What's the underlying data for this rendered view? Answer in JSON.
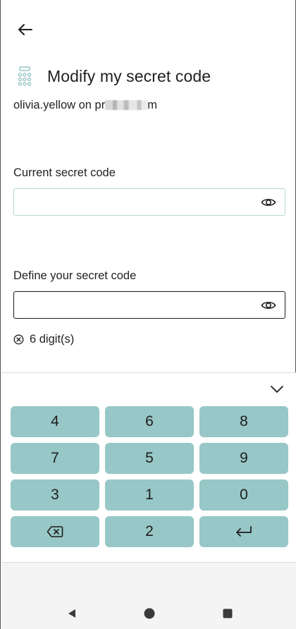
{
  "header": {
    "back_icon": "arrow-left-icon",
    "title": "Modify my secret code",
    "title_icon": "keypad-icon",
    "account_prefix": "olivia.yellow on pr",
    "account_suffix": "m"
  },
  "current_code": {
    "label": "Current secret code",
    "value": "",
    "toggle_icon": "eye-icon"
  },
  "new_code": {
    "label": "Define your secret code",
    "value": "",
    "toggle_icon": "eye-icon"
  },
  "rules": [
    {
      "icon": "x-circle-icon",
      "text": "6 digit(s)"
    }
  ],
  "keyboard": {
    "collapse_icon": "chevron-down-icon",
    "keys": [
      "4",
      "6",
      "8",
      "7",
      "5",
      "9",
      "3",
      "1",
      "0",
      "",
      "2",
      ""
    ],
    "key_icons": [
      "backspace-icon",
      "enter-icon"
    ]
  },
  "navbar": {
    "icons": [
      "back-triangle-icon",
      "home-circle-icon",
      "recents-square-icon"
    ]
  },
  "colors": {
    "key_fill": "#97c7c6",
    "current_field_border": "#b6d9d6",
    "new_field_border": "#1d1d1d",
    "text": "#1d1d1d"
  }
}
